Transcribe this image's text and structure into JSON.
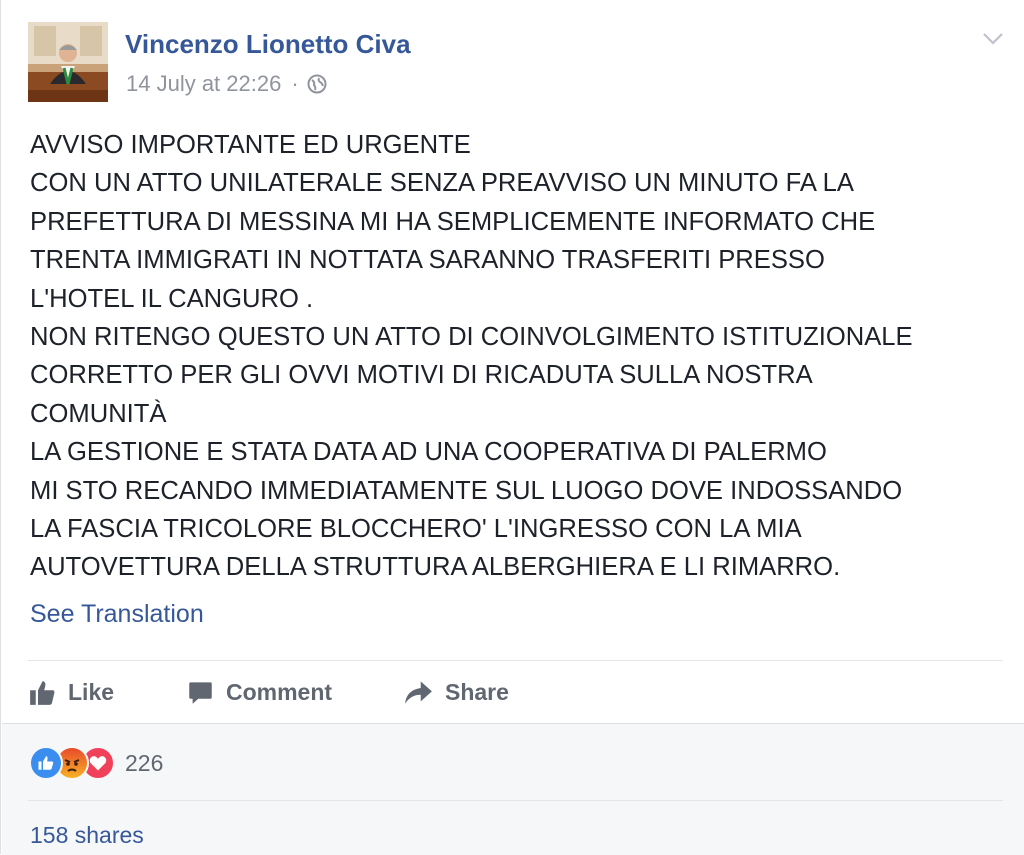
{
  "post": {
    "author": "Vincenzo Lionetto Civa",
    "timestamp": "14 July at 22:26",
    "separator": "·",
    "privacy_icon": "globe-icon",
    "menu_icon": "chevron-down-icon",
    "text_lines": [
      "AVVISO IMPORTANTE ED URGENTE",
      "CON UN ATTO UNILATERALE SENZA PREAVVISO UN MINUTO FA LA",
      "PREFETTURA DI MESSINA MI HA SEMPLICEMENTE INFORMATO CHE",
      "TRENTA IMMIGRATI IN NOTTATA SARANNO TRASFERITI PRESSO",
      "L'HOTEL IL CANGURO .",
      "NON RITENGO QUESTO UN ATTO DI COINVOLGIMENTO ISTITUZIONALE",
      "CORRETTO PER GLI OVVI MOTIVI DI RICADUTA SULLA NOSTRA",
      "COMUNITÀ",
      "LA GESTIONE E STATA DATA AD UNA COOPERATIVA DI PALERMO",
      "MI STO RECANDO IMMEDIATAMENTE SUL LUOGO DOVE INDOSSANDO",
      "LA FASCIA TRICOLORE BLOCCHERO' L'INGRESSO CON LA MIA",
      "AUTOVETTURA DELLA STRUTTURA ALBERGHIERA E LI RIMARRO."
    ],
    "see_translation": "See Translation"
  },
  "actions": {
    "like": "Like",
    "comment": "Comment",
    "share": "Share"
  },
  "footer": {
    "reaction_count": "226",
    "reactions": [
      "like",
      "angry",
      "love"
    ],
    "shares": "158 shares"
  },
  "colors": {
    "link": "#365899",
    "text": "#1d2129",
    "muted": "#90949c",
    "action": "#606770",
    "footer_bg": "#f6f7f9"
  }
}
